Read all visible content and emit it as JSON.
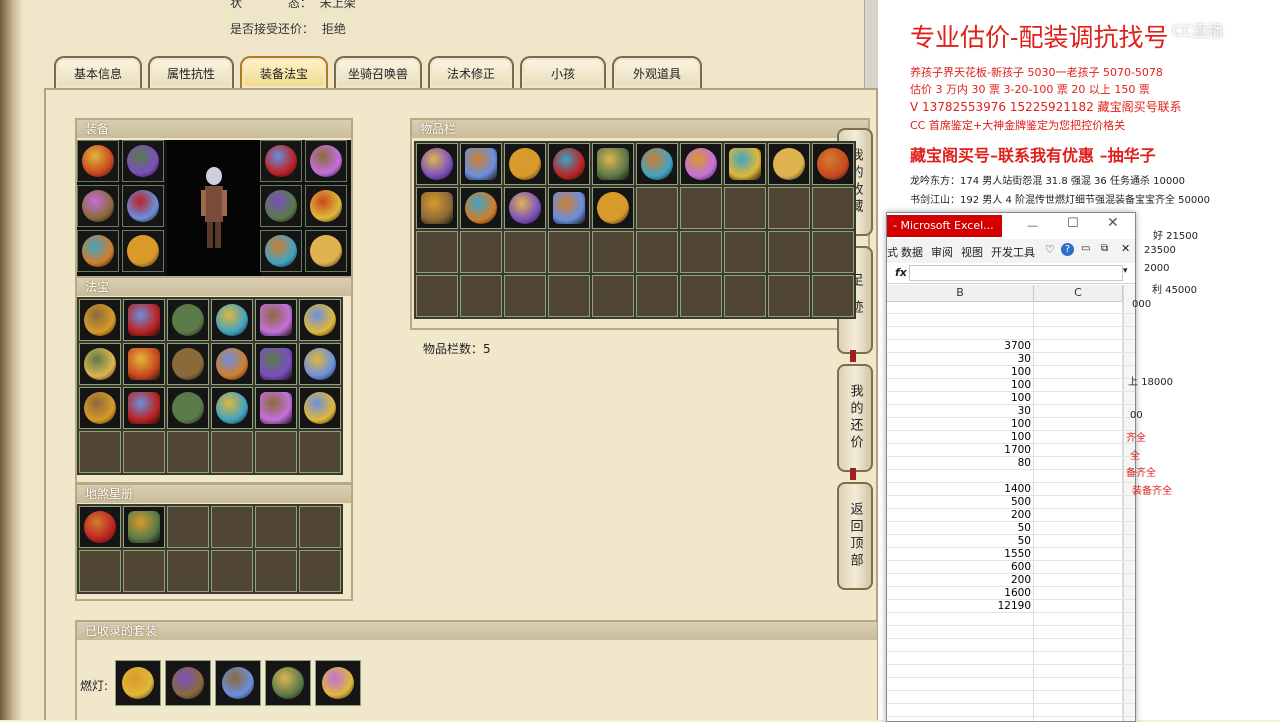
{
  "game": {
    "status_label": "状",
    "status_label2": "态：",
    "status_value": "未上架",
    "counter_label": "是否接受还价：",
    "counter_value": "拒绝",
    "tabs": [
      "基本信息",
      "属性抗性",
      "装备法宝",
      "坐骑召唤兽",
      "法术修正",
      "小孩",
      "外观道具"
    ],
    "active_tab": "装备法宝",
    "sections": {
      "equipment": "装备",
      "treasure": "法宝",
      "tianji": "地煞星册",
      "inventory": "物品栏",
      "collected_sets": "已收录的套装"
    },
    "inventory_count_label": "物品栏数：5",
    "set_name": "燃灯:",
    "side_buttons": [
      "我的收藏",
      "足迹",
      "我的还价",
      "返回顶部"
    ]
  },
  "doc": {
    "heading": "专业估价-配装调抗找号",
    "watermark": "CC直播",
    "lines": [
      "养孩子界天花板-新孩子 5030一老孩子 5070-5078",
      "估价 3 万内 30 票    3-20-100 票      20 以上 150 票",
      "V 13782553976    15225921182   藏宝阁买号联系",
      "CC 首席鉴定+大神金牌鉴定为您把控价格关"
    ],
    "promo": "藏宝阁买号–联系我有优惠 –抽华子",
    "entries": [
      "龙吟东方：174 男人站街怨混 31.8 强混 36 任务通杀 10000",
      "书剑江山：192 男人 4 阶混传世燃灯细节强混装备宝宝齐全 50000"
    ],
    "partial_right": [
      {
        "text": "好 21500",
        "red": false
      },
      {
        "text": "23500",
        "red": false
      },
      {
        "text": "2000",
        "red": false
      },
      {
        "text": "利 45000",
        "red": false
      },
      {
        "text": "000",
        "red": false
      },
      {
        "text": "上 18000",
        "red": false
      },
      {
        "text": "00",
        "red": false
      },
      {
        "text": "齐全",
        "red": true
      },
      {
        "text": "全",
        "red": true
      },
      {
        "text": "备齐全",
        "red": true
      },
      {
        "text": "装备齐全",
        "red": true
      }
    ]
  },
  "excel": {
    "title": "- Microsoft Excel...",
    "ribbon_tabs": [
      "式",
      "数据",
      "审阅",
      "视图",
      "开发工具"
    ],
    "fx": "fx",
    "columns": [
      "B",
      "C"
    ],
    "values": [
      "",
      "",
      "",
      "3700",
      "30",
      "100",
      "100",
      "100",
      "30",
      "100",
      "100",
      "1700",
      "80",
      "",
      "1400",
      "500",
      "200",
      "50",
      "50",
      "1550",
      "600",
      "200",
      "1600",
      "12190"
    ],
    "colors": {
      "title_bg": "#d40000"
    }
  }
}
